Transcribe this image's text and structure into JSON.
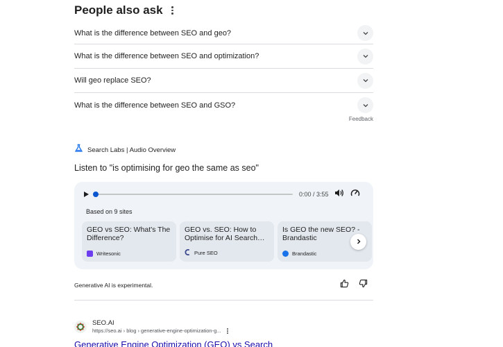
{
  "people_also_ask": {
    "title": "People also ask",
    "questions": [
      "What is the difference between SEO and geo?",
      "What is the difference between SEO and optimization?",
      "Will geo replace SEO?",
      "What is the difference between SEO and GSO?"
    ],
    "feedback_label": "Feedback"
  },
  "search_labs": {
    "header": "Search Labs | Audio Overview",
    "listen_title": "Listen to \"is optimising for geo the same as seo\"",
    "player": {
      "time": "0:00 / 3:55",
      "progress": 0
    },
    "based_on": "Based on 9 sites",
    "sources": [
      {
        "title": "GEO vs SEO: What's The Difference?",
        "site": "Writesonic",
        "icon": "writesonic-icon",
        "color": "#7c3aed"
      },
      {
        "title": "GEO vs. SEO: How to Optimise for AI Search…",
        "site": "Pure SEO",
        "icon": "pure-seo-icon",
        "color": "#3d4a8f"
      },
      {
        "title": "Is GEO the new SEO? - Brandastic",
        "site": "Brandastic",
        "icon": "brandastic-icon",
        "color": "#1a73e8"
      }
    ],
    "disclaimer": "Generative AI is experimental."
  },
  "result": {
    "site_name": "SEO.AI",
    "url": "https://seo.ai › blog › generative-engine-optimization-g...",
    "title": "Generative Engine Optimization (GEO) vs Search"
  },
  "colors": {
    "link": "#1a0dab",
    "accent": "#0b57d0",
    "card_bg": "#f0f4f9"
  }
}
